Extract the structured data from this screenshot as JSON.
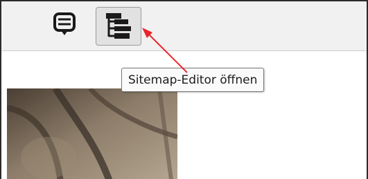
{
  "toolbar": {
    "buttons": [
      {
        "icon": "comment-icon"
      },
      {
        "icon": "sitemap-tree-icon",
        "active": true
      }
    ]
  },
  "tooltip": {
    "text": "Sitemap-Editor öffnen"
  },
  "colors": {
    "arrow": "#e8262b",
    "toolbar_bg": "#f1f1f1",
    "active_button_bg": "#e2e2e2"
  }
}
